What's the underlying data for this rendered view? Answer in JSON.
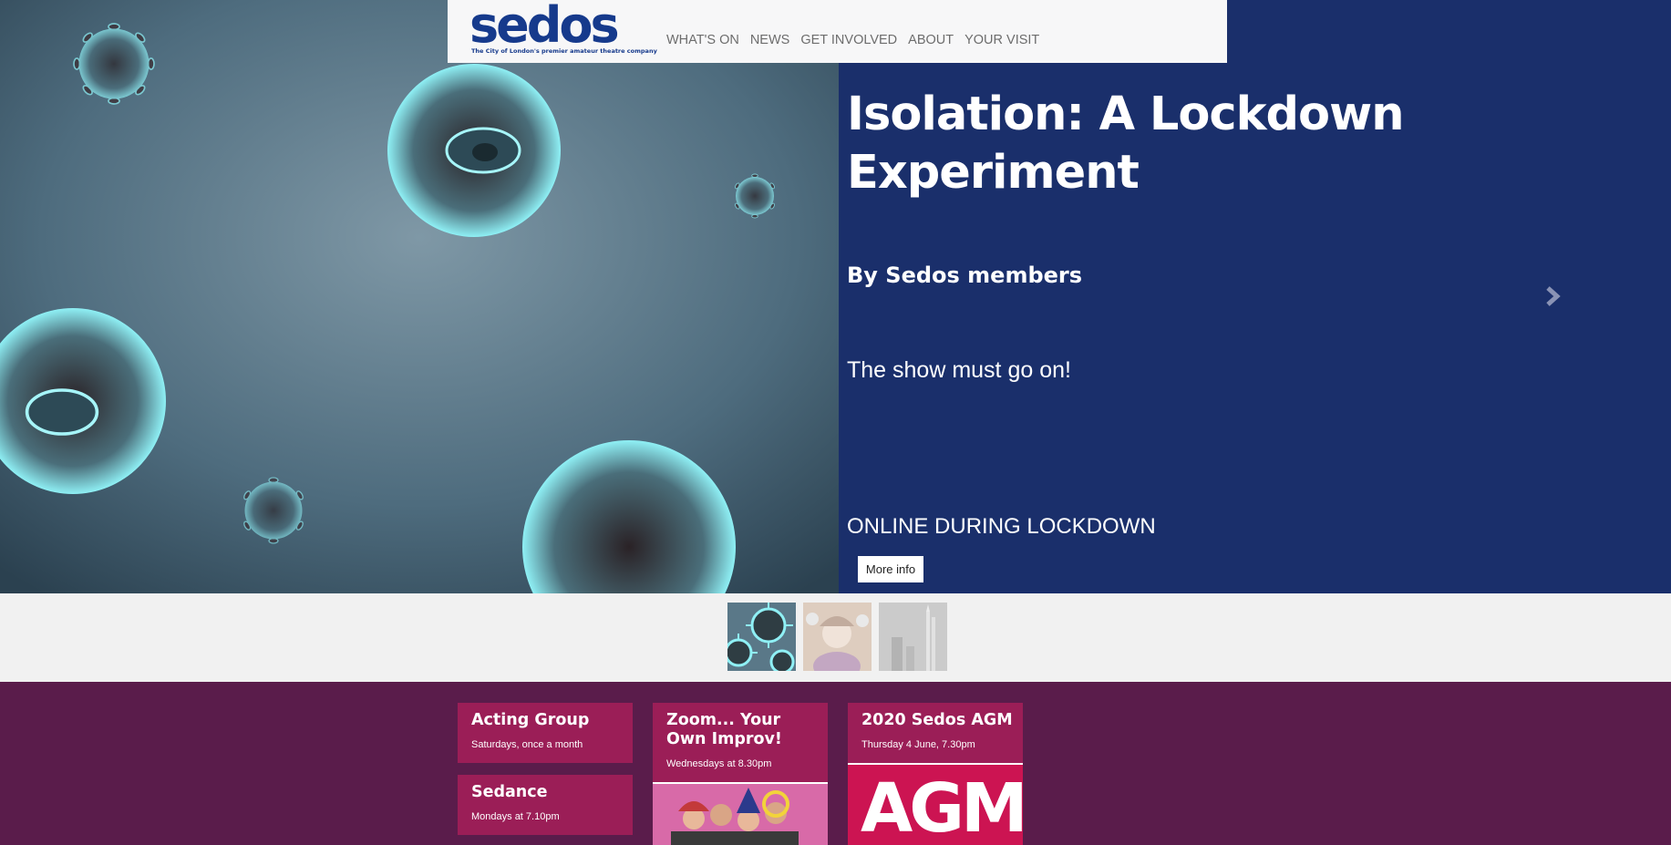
{
  "nav": {
    "logo_text": "sedos",
    "logo_tagline": "The City of London's premier amateur theatre company",
    "items": [
      {
        "label": "WHAT'S ON"
      },
      {
        "label": "NEWS"
      },
      {
        "label": "GET INVOLVED"
      },
      {
        "label": "ABOUT"
      },
      {
        "label": "YOUR VISIT"
      }
    ]
  },
  "hero": {
    "title": "Isolation: A Lockdown Experiment",
    "byline": "By Sedos members",
    "tagline": "The show must go on!",
    "when": "ONLINE DURING LOCKDOWN",
    "button_label": "More info",
    "next_icon": "chevron-right-icon",
    "panel_color": "#1a2f6b"
  },
  "thumbnails": [
    {
      "name": "virus-thumbnail",
      "active": true
    },
    {
      "name": "performer-thumbnail",
      "active": false
    },
    {
      "name": "skyline-thumbnail",
      "active": false
    }
  ],
  "events": {
    "background_color": "#5a1c4b",
    "card_color": "#9b1e57",
    "cards": [
      {
        "title": "Acting Group",
        "subtitle": "Saturdays, once a month"
      },
      {
        "title": "Sedance",
        "subtitle": "Mondays at 7.10pm"
      },
      {
        "title": "Zoom... Your Own Improv!",
        "subtitle": "Wednesdays at 8.30pm"
      },
      {
        "title": "2020 Sedos AGM",
        "subtitle": "Thursday 4 June, 7.30pm",
        "image_text": "AGM"
      }
    ]
  }
}
